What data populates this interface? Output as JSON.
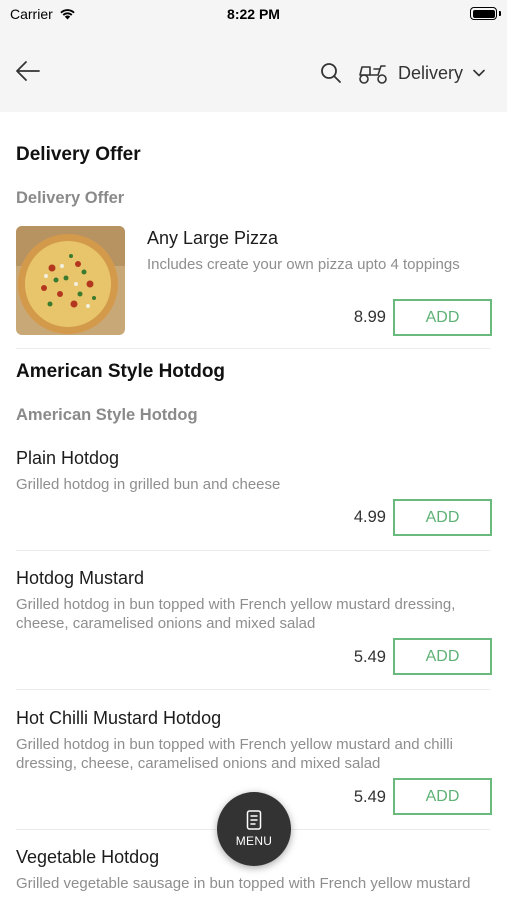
{
  "status_bar": {
    "carrier": "Carrier",
    "time": "8:22 PM"
  },
  "header": {
    "delivery_label": "Delivery"
  },
  "sections": [
    {
      "title": "Delivery Offer",
      "subtitle": "Delivery Offer",
      "items": [
        {
          "name": "Any Large Pizza",
          "description": "Includes create your own pizza upto 4 toppings",
          "price": "8.99",
          "add_label": "ADD"
        }
      ]
    },
    {
      "title": "American Style Hotdog",
      "subtitle": "American Style Hotdog",
      "items": [
        {
          "name": "Plain Hotdog",
          "description": "Grilled hotdog in grilled bun and cheese",
          "price": "4.99",
          "add_label": "ADD"
        },
        {
          "name": "Hotdog Mustard",
          "description_line1": "Grilled hotdog in bun topped with French yellow mustard dressing,",
          "description_line2": "cheese, caramelised onions and mixed salad",
          "price": "5.49",
          "add_label": "ADD"
        },
        {
          "name": "Hot Chilli Mustard Hotdog",
          "description_line1": "Grilled hotdog in bun topped with French yellow mustard and chilli",
          "description_line2": "dressing, cheese, caramelised onions and mixed salad",
          "price": "5.49",
          "add_label": "ADD"
        },
        {
          "name": "Vegetable Hotdog",
          "description_line1": "Grilled vegetable sausage in bun topped with French yellow mustard"
        }
      ]
    }
  ],
  "fab": {
    "label": "MENU"
  },
  "colors": {
    "accent": "#5fb276",
    "header_bg": "#f5f5f5",
    "fab_bg": "#333333"
  }
}
